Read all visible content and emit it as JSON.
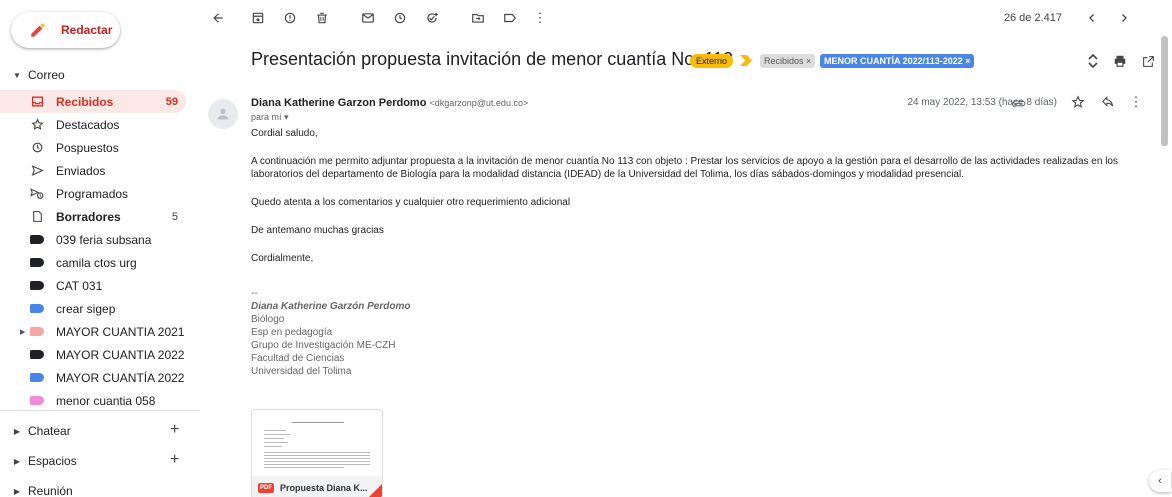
{
  "compose": {
    "label": "Redactar"
  },
  "sections": {
    "mail": "Correo",
    "chat": "Chatear",
    "spaces": "Espacios",
    "meet": "Reunión"
  },
  "nav": [
    {
      "label": "Recibidos",
      "count": "59",
      "icon": "inbox-icon",
      "active": true
    },
    {
      "label": "Destacados",
      "count": "",
      "icon": "star-icon"
    },
    {
      "label": "Pospuestos",
      "count": "",
      "icon": "clock-icon"
    },
    {
      "label": "Enviados",
      "count": "",
      "icon": "send-icon"
    },
    {
      "label": "Programados",
      "count": "",
      "icon": "scheduled-icon"
    },
    {
      "label": "Borradores",
      "count": "5",
      "icon": "draft-icon",
      "bold": true
    },
    {
      "label": "039 feria subsana",
      "count": "",
      "icon": "label-icon",
      "color": "#202124"
    },
    {
      "label": "camila ctos urg",
      "count": "",
      "icon": "label-icon",
      "color": "#202124"
    },
    {
      "label": "CAT 031",
      "count": "",
      "icon": "label-icon",
      "color": "#202124"
    },
    {
      "label": "crear sigep",
      "count": "",
      "icon": "label-icon",
      "color": "#4a86e8"
    },
    {
      "label": "MAYOR CUANTIA 2021",
      "count": "",
      "icon": "label-icon",
      "color": "#f4a6a6",
      "expandable": true
    },
    {
      "label": "MAYOR CUANTIA 2022",
      "count": "",
      "icon": "label-icon",
      "color": "#202124"
    },
    {
      "label": "MAYOR CUANTÍA 2022",
      "count": "",
      "icon": "label-icon",
      "color": "#4a86e8"
    },
    {
      "label": "menor cuantia 058",
      "count": "",
      "icon": "label-icon",
      "color": "#f28bd6"
    }
  ],
  "toolbar": {
    "pager": "26 de 2.417"
  },
  "message": {
    "subject": "Presentación propuesta invitación de menor cuantía No. 113",
    "chips": {
      "external": "Externo",
      "inbox": "Recibidos ×",
      "label": "MENOR CUANTÍA 2022/113-2022 ×"
    },
    "sender_name": "Diana Katherine Garzon Perdomo",
    "sender_addr": "<dkgarzonp@ut.edu.co>",
    "to": "para mí ▾",
    "date": "24 may 2022, 13:53 (hace 8 días)",
    "body": [
      "Cordial saludo,",
      "A continuación me permito adjuntar propuesta a la invitación de menor cuantía No 113 con objeto : Prestar los servicios de apoyo a la gestión para el desarrollo de las actividades realizadas en los laboratorios del departamento de Biología para la modalidad distancia (IDEAD) de la Universidad del Tolima, los días sábados-domingos y modalidad presencial.",
      "Quedo atenta a los comentarios y cualquier otro requerimiento adicional",
      "De antemano muchas gracias",
      "Cordialmente,"
    ],
    "signature": {
      "dashes": "--",
      "name": "Diana Katherine Garzón Perdomo",
      "lines": [
        "Biólogo",
        "Esp en pedagogía",
        "Grupo de Investigación ME-CZH",
        "Facultad de Ciencias",
        "Universidad del Tolima"
      ]
    },
    "attachment": {
      "badge": "PDF",
      "name": "Propuesta Diana K..."
    }
  }
}
